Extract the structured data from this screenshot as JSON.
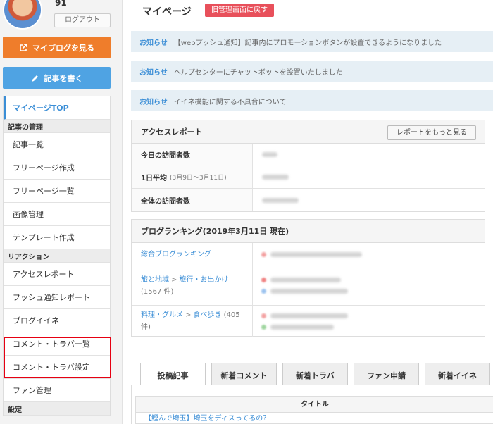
{
  "user": {
    "name": "91",
    "logout_label": "ログアウト"
  },
  "sidebar": {
    "myblog_label": "マイブログを見る",
    "write_label": "記事を書く",
    "menu": [
      {
        "type": "item",
        "label": "マイページTOP",
        "active": true,
        "name": "sidebar-item-mypage-top"
      },
      {
        "type": "head",
        "label": "記事の管理"
      },
      {
        "type": "item",
        "label": "記事一覧",
        "name": "sidebar-item-article-list"
      },
      {
        "type": "item",
        "label": "フリーページ作成",
        "name": "sidebar-item-free-page-create"
      },
      {
        "type": "item",
        "label": "フリーページ一覧",
        "name": "sidebar-item-free-page-list"
      },
      {
        "type": "item",
        "label": "画像管理",
        "name": "sidebar-item-image-manage"
      },
      {
        "type": "item",
        "label": "テンプレート作成",
        "name": "sidebar-item-template-create"
      },
      {
        "type": "head",
        "label": "リアクション"
      },
      {
        "type": "item",
        "label": "アクセスレポート",
        "name": "sidebar-item-access-report"
      },
      {
        "type": "item",
        "label": "プッシュ通知レポート",
        "name": "sidebar-item-push-report"
      },
      {
        "type": "item",
        "label": "ブログイイネ",
        "name": "sidebar-item-blog-iine"
      },
      {
        "type": "item",
        "label": "コメント・トラバ一覧",
        "name": "sidebar-item-comment-list"
      },
      {
        "type": "item",
        "label": "コメント・トラバ設定",
        "name": "sidebar-item-comment-settings"
      },
      {
        "type": "item",
        "label": "ファン管理",
        "name": "sidebar-item-fan-manage"
      },
      {
        "type": "head",
        "label": "設定"
      }
    ]
  },
  "main": {
    "title": "マイページ",
    "old_admin_label": "旧管理画面に戻す",
    "notices": [
      {
        "tag": "お知らせ",
        "text": "【webプッシュ通知】記事内にプロモーションボタンが設置できるようになりました"
      },
      {
        "tag": "お知らせ",
        "text": "ヘルプセンターにチャットボットを設置いたしました"
      },
      {
        "tag": "お知らせ",
        "text": "イイネ機能に関する不具合について"
      }
    ],
    "access_report": {
      "title": "アクセスレポート",
      "more_label": "レポートをもっと見る",
      "rows": [
        {
          "label": "今日の訪問者数",
          "sub": ""
        },
        {
          "label": "1日平均",
          "sub": "(3月9日〜3月11日)"
        },
        {
          "label": "全体の訪問者数",
          "sub": ""
        }
      ]
    },
    "ranking": {
      "title": "ブログランキング(2019年3月11日 現在)",
      "rows": [
        {
          "parts": [
            "総合ブログランキング"
          ],
          "count": "",
          "values": 1
        },
        {
          "parts": [
            "旅と地域",
            "旅行・お出かけ"
          ],
          "count": "(1567 件)",
          "values": 2
        },
        {
          "parts": [
            "料理・グルメ",
            "食べ歩き"
          ],
          "count": "(405 件)",
          "values": 2
        }
      ],
      "separator": ">"
    },
    "tabs": [
      "投稿記事",
      "新着コメント",
      "新着トラバ",
      "ファン申請",
      "新着イイネ"
    ],
    "table": {
      "header": "タイトル",
      "first_row": "【鰹んで埼玉】埼玉をディスってるの？"
    }
  },
  "colors": {
    "accent": "#3b8ed6",
    "orange": "#ef7d2b",
    "blue_btn": "#4fa3e3",
    "red_btn": "#e8505b",
    "highlight": "#e60012"
  }
}
